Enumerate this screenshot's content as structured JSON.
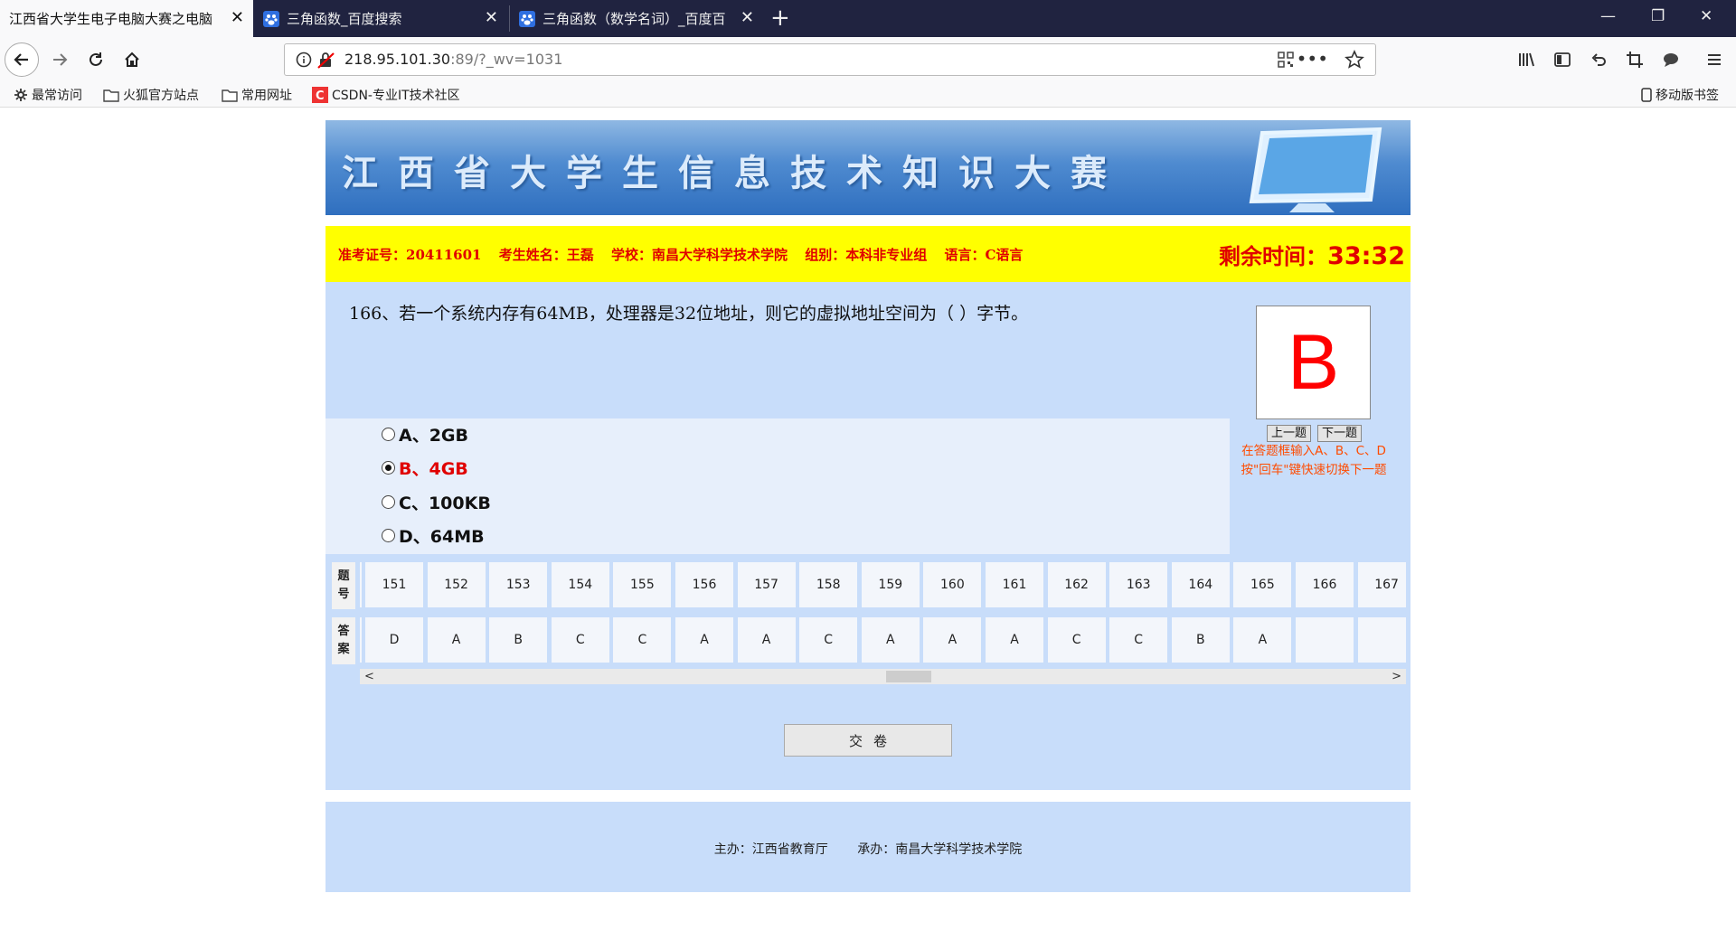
{
  "browser": {
    "tabs": [
      {
        "title": "江西省大学生电子电脑大赛之电脑",
        "active": true
      },
      {
        "title": "三角函数_百度搜索",
        "active": false
      },
      {
        "title": "三角函数（数学名词）_百度百",
        "active": false
      }
    ],
    "url_host": "218.95.101.30",
    "url_rest": ":89/?_wv=1031",
    "bookmarks": [
      "最常访问",
      "火狐官方站点",
      "常用网址",
      "CSDN-专业IT技术社区"
    ],
    "mobile_bookmarks": "移动版书签"
  },
  "banner": {
    "title": "江西省大学生信息技术知识大赛"
  },
  "info": {
    "exam_id": "准考证号：20411601",
    "name": "考生姓名：王磊",
    "school": "学校：南昌大学科学技术学院",
    "group": "组别：本科非专业组",
    "language": "语言：C语言",
    "timer_label": "剩余时间：",
    "timer_value": "33:32"
  },
  "question": {
    "text": "166、若一个系统内存有64MB，处理器是32位地址，则它的虚拟地址空间为（    ）字节。",
    "options": [
      {
        "label": "A、2GB",
        "selected": false
      },
      {
        "label": "B、4GB",
        "selected": true
      },
      {
        "label": "C、100KB",
        "selected": false
      },
      {
        "label": "D、64MB",
        "selected": false
      }
    ],
    "answer_box": "B",
    "prev_label": "上一题",
    "next_label": "下一题",
    "hint_line1": "在答题框输入A、B、C、D",
    "hint_line2": "按\"回车\"键快速切换下一题"
  },
  "grid": {
    "number_label_1": "题",
    "number_label_2": "号",
    "answer_label_1": "答",
    "answer_label_2": "案",
    "numbers": [
      "151",
      "152",
      "153",
      "154",
      "155",
      "156",
      "157",
      "158",
      "159",
      "160",
      "161",
      "162",
      "163",
      "164",
      "165",
      "166",
      "167"
    ],
    "answers": [
      "D",
      "A",
      "B",
      "C",
      "C",
      "A",
      "A",
      "C",
      "A",
      "A",
      "A",
      "C",
      "C",
      "B",
      "A",
      "",
      ""
    ],
    "scroll_position": 0.62
  },
  "submit_label": "交卷",
  "footer": {
    "sponsor": "主办：江西省教育厅",
    "organizer": "承办：南昌大学科学技术学院"
  },
  "colors": {
    "accent_red": "#e00000",
    "info_bg": "#ffff00",
    "panel_bg": "#c8ddfa"
  }
}
